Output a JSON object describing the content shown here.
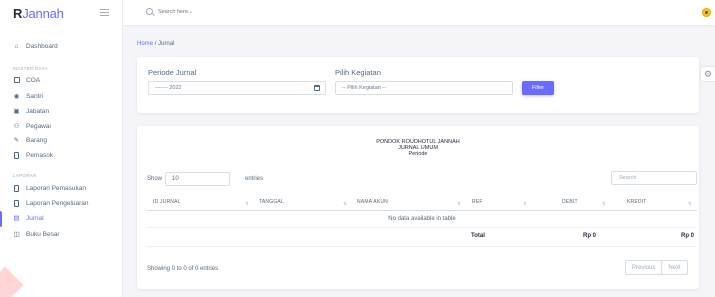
{
  "brand": {
    "initial": "R",
    "rest": "Jannah"
  },
  "sidebar": {
    "dashboard": "Dashboard",
    "master_header": "MASTER DATA",
    "master_items": [
      {
        "label": "COA",
        "icon": "square-icon"
      },
      {
        "label": "Santri",
        "icon": "user-circle-icon"
      },
      {
        "label": "Jabatan",
        "icon": "id-card-icon"
      },
      {
        "label": "Pegawai",
        "icon": "user-check-icon"
      },
      {
        "label": "Barang",
        "icon": "pen-icon"
      },
      {
        "label": "Pemasok",
        "icon": "receipt-icon"
      }
    ],
    "laporan_header": "LAPORAN",
    "laporan_items": [
      {
        "label": "Laporan Pemasukan",
        "icon": "file-icon"
      },
      {
        "label": "Laporan Pengeluaran",
        "icon": "file-icon"
      },
      {
        "label": "Jurnal",
        "icon": "calendar-icon",
        "active": true
      },
      {
        "label": "Buku Besar",
        "icon": "book-icon"
      }
    ]
  },
  "topbar": {
    "search_placeholder": "Search here..."
  },
  "breadcrumb": {
    "home": "Home",
    "separator": "/",
    "current": "Jurnal"
  },
  "filter": {
    "periode_label": "Periode Jurnal",
    "periode_value": "------- 2022",
    "kegiatan_label": "Pilih Kegiatan",
    "kegiatan_value": "-- Pilih Kegiatan --",
    "button": "Filter"
  },
  "report": {
    "org": "PONDOK ROUDHOTUL JANNAH",
    "title": "JURNAL UMUM",
    "subtitle": "Periode",
    "show_label": "Show",
    "entries_value": "10",
    "entries_label": "entries",
    "search_placeholder": "Search",
    "columns": [
      "ID JURNAL",
      "TANGGAL",
      "NAMA AKUN",
      "REF",
      "DEBIT",
      "KREDIT"
    ],
    "empty_message": "No data available in table",
    "total_label": "Total",
    "total_debit": "Rp 0",
    "total_kredit": "Rp 0",
    "info": "Showing 0 to 0 of 0 entries",
    "previous": "Previous",
    "next": "Next"
  },
  "colors": {
    "primary": "#696cff",
    "text": "#566a7f",
    "background": "#f5f5f9"
  }
}
